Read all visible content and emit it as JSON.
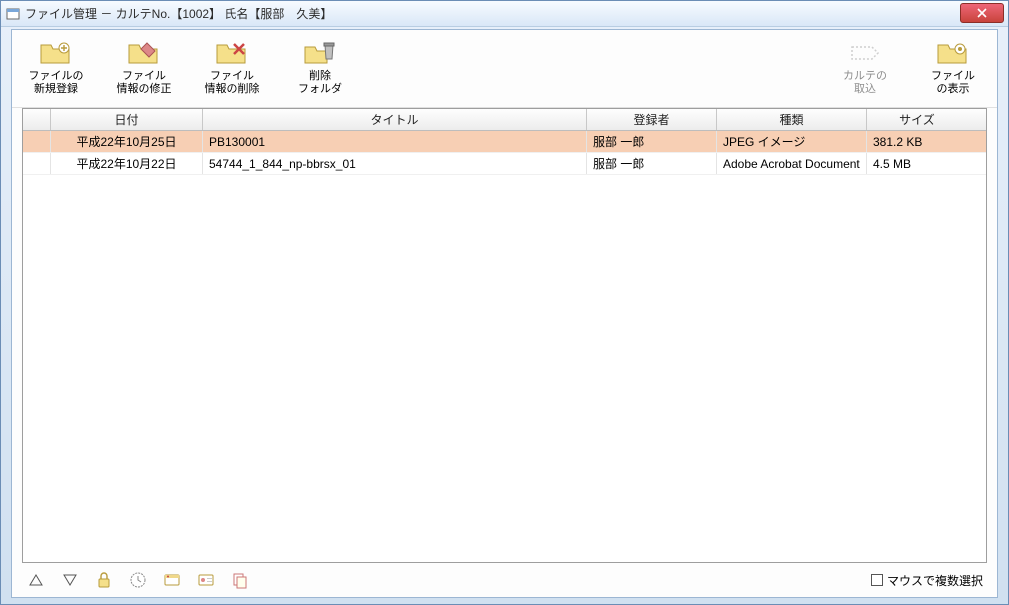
{
  "window": {
    "title": "ファイル管理 － カルテNo.【1002】 氏名【服部　久美】"
  },
  "toolbar": {
    "new_file": "ファイルの\n新規登録",
    "edit_info": "ファイル\n情報の修正",
    "delete_info": "ファイル\n情報の削除",
    "delete_folder": "削除\nフォルダ",
    "import_karte": "カルテの\n取込",
    "view_file": "ファイル\nの表示"
  },
  "columns": {
    "date": "日付",
    "title": "タイトル",
    "registrant": "登録者",
    "type": "種類",
    "size": "サイズ"
  },
  "rows": [
    {
      "date": "平成22年10月25日",
      "title": "PB130001",
      "registrant": "服部  一郎",
      "type": "JPEG イメージ",
      "size": "381.2 KB",
      "selected": true
    },
    {
      "date": "平成22年10月22日",
      "title": "54744_1_844_np-bbrsx_01",
      "registrant": "服部  一郎",
      "type": "Adobe Acrobat Document",
      "size": "4.5 MB",
      "selected": false
    }
  ],
  "footer": {
    "multi_select": "マウスで複数選択"
  }
}
